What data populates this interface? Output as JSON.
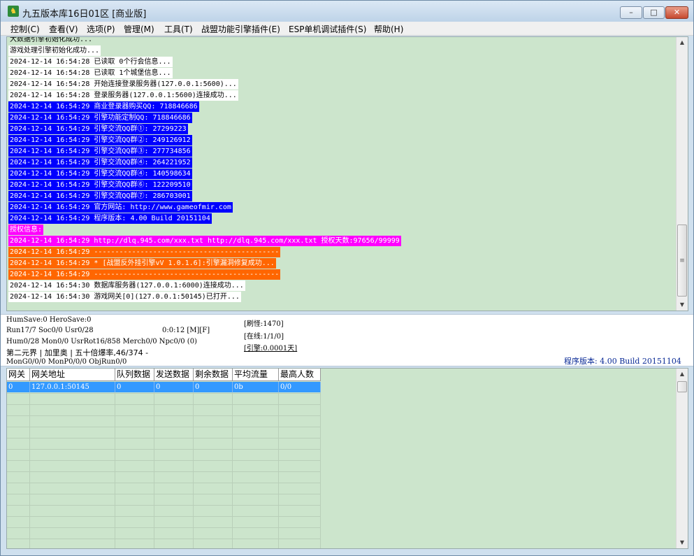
{
  "window": {
    "title": "九五版本库16日01区 [商业版]",
    "icon": "game-app-icon",
    "controls": {
      "minimize": "–",
      "maximize": "□",
      "close": "✕"
    }
  },
  "menu": [
    "控制(C)",
    "查看(V)",
    "选项(P)",
    "管理(M)",
    "工具(T)",
    "战盟功能引擎插件(E)",
    "ESP单机调试插件(S)",
    "帮助(H)"
  ],
  "log": {
    "lines": [
      {
        "text": "大数据引擎初始化成功...",
        "style": "plain"
      },
      {
        "text": "游戏处理引擎初始化成功...",
        "style": "white"
      },
      {
        "text": "2024-12-14 16:54:28 已读取 0个行会信息...",
        "style": "white"
      },
      {
        "text": "2024-12-14 16:54:28 已读取 1个城堡信息...",
        "style": "white"
      },
      {
        "text": "2024-12-14 16:54:28 开始连接登录服务器(127.0.0.1:5600)...",
        "style": "white"
      },
      {
        "text": "2024-12-14 16:54:28 登录服务器(127.0.0.1:5600)连接成功...",
        "style": "white"
      },
      {
        "text": "2024-12-14 16:54:29 商业登录器购买QQ: 718846686",
        "style": "blue"
      },
      {
        "text": "2024-12-14 16:54:29 引擎功能定制QQ: 718846686",
        "style": "blue"
      },
      {
        "text": "2024-12-14 16:54:29 引擎交流QQ群①: 27299223",
        "style": "blue"
      },
      {
        "text": "2024-12-14 16:54:29 引擎交流QQ群②: 249126912",
        "style": "blue"
      },
      {
        "text": "2024-12-14 16:54:29 引擎交流QQ群③: 277734856",
        "style": "blue"
      },
      {
        "text": "2024-12-14 16:54:29 引擎交流QQ群④: 264221952",
        "style": "blue"
      },
      {
        "text": "2024-12-14 16:54:29 引擎交流QQ群④: 140598634",
        "style": "blue"
      },
      {
        "text": "2024-12-14 16:54:29 引擎交流QQ群⑥: 122209510",
        "style": "blue"
      },
      {
        "text": "2024-12-14 16:54:29 引擎交流QQ群⑦: 286703001",
        "style": "blue"
      },
      {
        "text": "2024-12-14 16:54:29 官方网站: http://www.gameofmir.com",
        "style": "blue"
      },
      {
        "text": "2024-12-14 16:54:29 程序版本: 4.00 Build 20151104",
        "style": "blue"
      },
      {
        "text": "授权信息:",
        "style": "magenta"
      },
      {
        "text": "2024-12-14 16:54:29 http://dlq.945.com/xxx.txt http://dlq.945.com/xxx.txt 授权天数:97656/99999",
        "style": "magenta"
      },
      {
        "text": "2024-12-14 16:54:29 --------------------------------------------",
        "style": "orange"
      },
      {
        "text": "2024-12-14 16:54:29 * [战盟反外挂引擎vV 1.0.1.6]:引擎漏洞修复成功...",
        "style": "orange"
      },
      {
        "text": "2024-12-14 16:54:29 --------------------------------------------",
        "style": "orange"
      },
      {
        "text": "2024-12-14 16:54:30 数据库服务器(127.0.0.1:6000)连接成功...",
        "style": "white"
      },
      {
        "text": "2024-12-14 16:54:30 游戏网关[0](127.0.0.1:50145)已打开...",
        "style": "white"
      }
    ],
    "colors": {
      "background": "#cce5cc",
      "blue": "#0000ff",
      "magenta": "#ff00ff",
      "orange": "#ff6600"
    }
  },
  "status": {
    "hum_save": "HumSave:0 HeroSave:0",
    "run": "Run17/7 Soc0/0 Usr0/28",
    "timer": "0:0:12 [M][F]",
    "hum": "Hum0/28 Mon0/0 UsrRot16/858 Merch0/0 Npc0/0 (0)",
    "zone": "第二元界 | 加里奥 | 五十倍爆率,46/374 -",
    "mon": "MonG0/0/0 MonP0/0/0 ObjRun0/0",
    "refresh": "[刷怪:1470]",
    "online": "[在线:1/1/0]",
    "engine": "[引擎:0.0001天]",
    "version": "程序版本: 4.00 Build 20151104"
  },
  "gateway_table": {
    "headers": [
      "网关",
      "网关地址",
      "队列数据",
      "发送数据",
      "剩余数据",
      "平均流量",
      "最高人数"
    ],
    "rows": [
      [
        "0",
        "127.0.0.1:50145",
        "0",
        "0",
        "0",
        "0b",
        "0/0"
      ]
    ]
  }
}
